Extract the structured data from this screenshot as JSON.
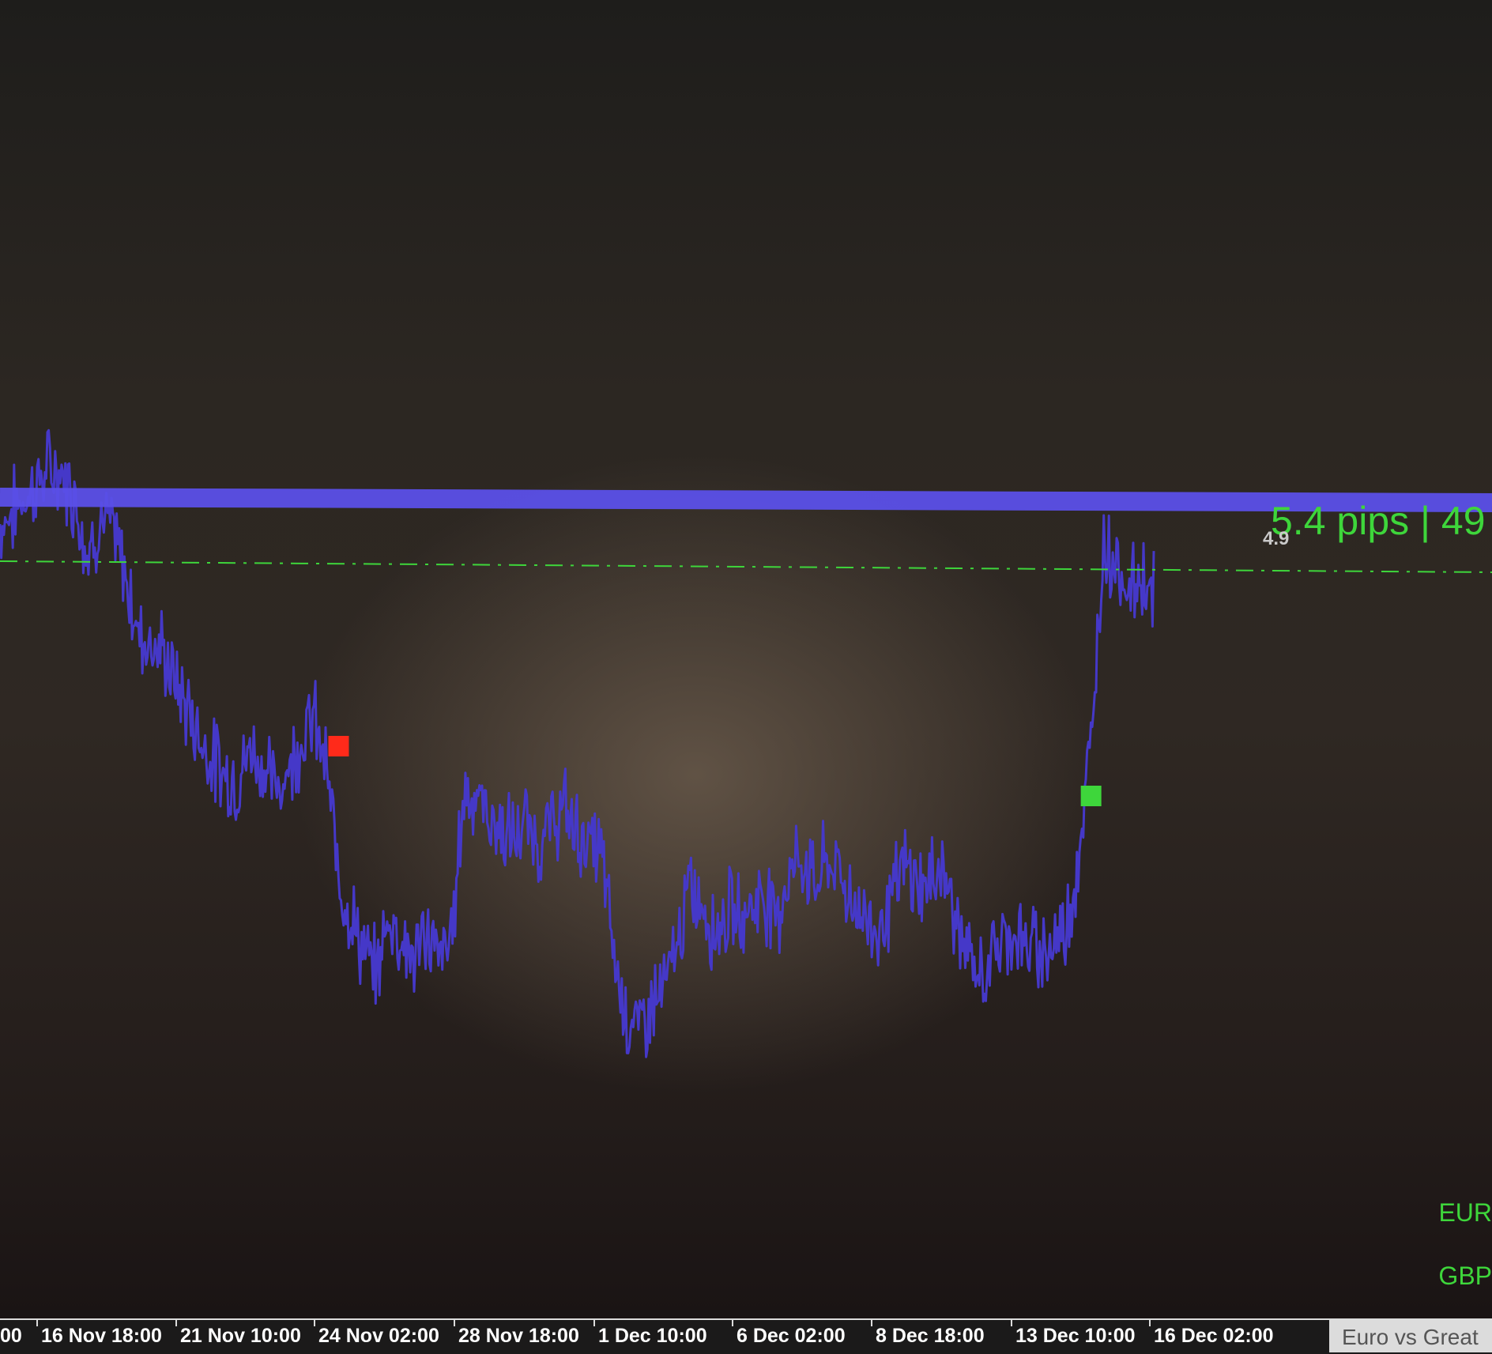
{
  "chart_data": {
    "type": "line",
    "series": [
      {
        "values": [
          0.5,
          0.7,
          0.9,
          1.1,
          1.3,
          1.2,
          0.9,
          0.1,
          0.6,
          0.4,
          -0.2,
          -1.0,
          -1.1,
          -1.3,
          -1.7,
          -2.1,
          -2.5,
          -2.8,
          -3.0,
          -3.1,
          -2.6,
          -2.9,
          -3.2,
          -2.9,
          -2.5,
          -2.2,
          -2.9,
          -4.4,
          -5.0,
          -5.5,
          -5.8,
          -5.0,
          -5.3,
          -5.6,
          -5.2,
          -5.6,
          -5.3,
          -3.2,
          -3.3,
          -3.6,
          -3.8,
          -3.9,
          -3.7,
          -4.0,
          -3.7,
          -3.5,
          -3.8,
          -4.0,
          -4.1,
          -5.6,
          -6.4,
          -6.6,
          -6.2,
          -6.0,
          -5.4,
          -4.6,
          -4.8,
          -5.2,
          -4.9,
          -5.0,
          -4.8,
          -4.7,
          -5.0,
          -4.3,
          -4.2,
          -4.5,
          -4.2,
          -4.4,
          -4.8,
          -5.0,
          -5.2,
          -4.8,
          -4.3,
          -4.5,
          -4.6,
          -4.2,
          -4.9,
          -5.5,
          -5.9,
          -5.6,
          -5.3,
          -5.2,
          -5.5,
          -5.4,
          -5.4,
          -5.1,
          -4.2,
          -2.6,
          0.3,
          0.0,
          -0.4,
          -0.2,
          -0.4
        ]
      }
    ],
    "x_ticks": [
      "00",
      "16 Nov 18:00",
      "21 Nov 10:00",
      "24 Nov 02:00",
      "28 Nov 18:00",
      "1 Dec 10:00",
      "6 Dec 02:00",
      "8 Dec 18:00",
      "13 Dec 10:00",
      "16 Dec 02:00"
    ],
    "reference_lines": [
      {
        "style": "solid-band",
        "value": 0.4,
        "color": "#5b50e8"
      },
      {
        "style": "dash-dot",
        "value": 0.0,
        "color": "#3ed63b"
      }
    ],
    "markers": [
      {
        "shape": "square",
        "color": "#ff2a1a",
        "x_index": 27,
        "value": -2.6
      },
      {
        "shape": "square",
        "color": "#3ed63b",
        "x_index": 87,
        "value": -3.3
      }
    ],
    "line_color": "#4538c8",
    "grid": false,
    "pips_label": "5.4 pips | 49",
    "small_value": "4.9",
    "legend": [
      "EUR",
      "GBP"
    ],
    "symbol_tab": "Euro vs Great"
  }
}
